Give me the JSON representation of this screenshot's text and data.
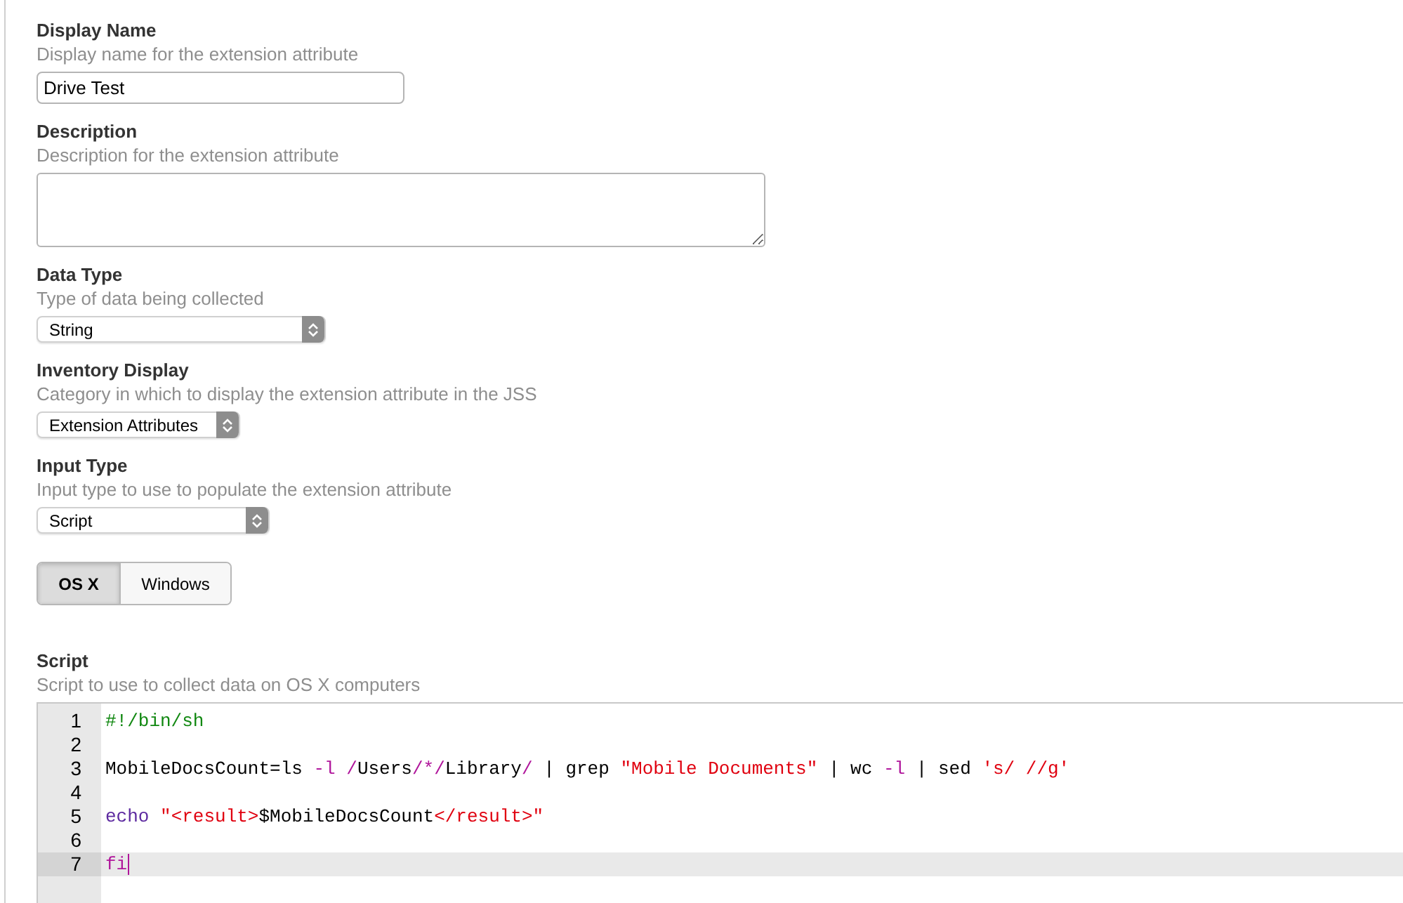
{
  "fields": [
    {
      "kind": "text",
      "label": "Display Name",
      "hint": "Display name for the extension attribute",
      "value": "Drive Test"
    },
    {
      "kind": "textarea",
      "label": "Description",
      "hint": "Description for the extension attribute"
    },
    {
      "kind": "select",
      "label": "Data Type",
      "hint": "Type of data being collected",
      "value": "String"
    },
    {
      "kind": "select",
      "label": "Inventory Display",
      "hint": "Category in which to display the extension attribute in the JSS",
      "value": "Extension Attributes"
    },
    {
      "kind": "select",
      "label": "Input Type",
      "hint": "Input type to use to populate the extension attribute",
      "value": "Script"
    }
  ],
  "platform_toggle": [
    {
      "label": "OS X",
      "selected": true
    },
    {
      "label": "Windows",
      "selected": false
    }
  ],
  "script": {
    "label": "Script",
    "hint": "Script to use to collect data on OS X computers",
    "lines": [
      {
        "number": "1",
        "active": false,
        "tokens": [
          {
            "kind": "comment",
            "text": "#!/bin/sh"
          }
        ]
      },
      {
        "number": "2",
        "active": false
      },
      {
        "number": "3",
        "active": false,
        "tokens": [
          {
            "kind": "plain",
            "text": "MobileDocsCount=ls "
          },
          {
            "kind": "flag",
            "text": "-l"
          },
          {
            "kind": "flag",
            "text": " /"
          },
          {
            "kind": "plain",
            "text": "Users"
          },
          {
            "kind": "flag",
            "text": "/*/"
          },
          {
            "kind": "plain",
            "text": "Library"
          },
          {
            "kind": "flag",
            "text": "/"
          },
          {
            "kind": "plain",
            "text": " | grep "
          },
          {
            "kind": "string",
            "text": "\"Mobile Documents\""
          },
          {
            "kind": "plain",
            "text": " | wc "
          },
          {
            "kind": "flag",
            "text": "-l"
          },
          {
            "kind": "plain",
            "text": " | sed "
          },
          {
            "kind": "string",
            "text": "'s/ //g'"
          }
        ]
      },
      {
        "number": "4",
        "active": false
      },
      {
        "number": "5",
        "active": false,
        "tokens": [
          {
            "kind": "keyword",
            "text": "echo"
          },
          {
            "kind": "string",
            "text": " \"<result>"
          },
          {
            "kind": "plain",
            "text": "$MobileDocsCount"
          },
          {
            "kind": "string",
            "text": "</result>\""
          }
        ]
      },
      {
        "number": "6",
        "active": false
      },
      {
        "number": "7",
        "active": true,
        "tokens": [
          {
            "kind": "flag",
            "text": "fi"
          }
        ]
      }
    ]
  }
}
